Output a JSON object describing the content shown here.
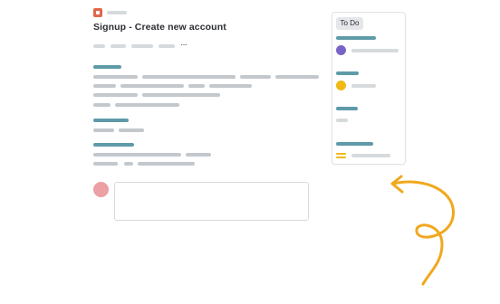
{
  "page": {
    "title": "Signup - Create new account",
    "more_label": "···"
  },
  "board": {
    "column_label": "To Do"
  },
  "colors": {
    "task_icon": "#e0674d",
    "accent_teal": "#5f9aa8",
    "avatar": "#eda0a3",
    "status_purple": "#7a63c7",
    "status_yellow": "#f0b914",
    "arrow": "#f0a81e"
  },
  "icons": {
    "task": "task-icon",
    "more": "more-icon",
    "priority": "priority-icon",
    "arrow": "curved-arrow-icon"
  }
}
